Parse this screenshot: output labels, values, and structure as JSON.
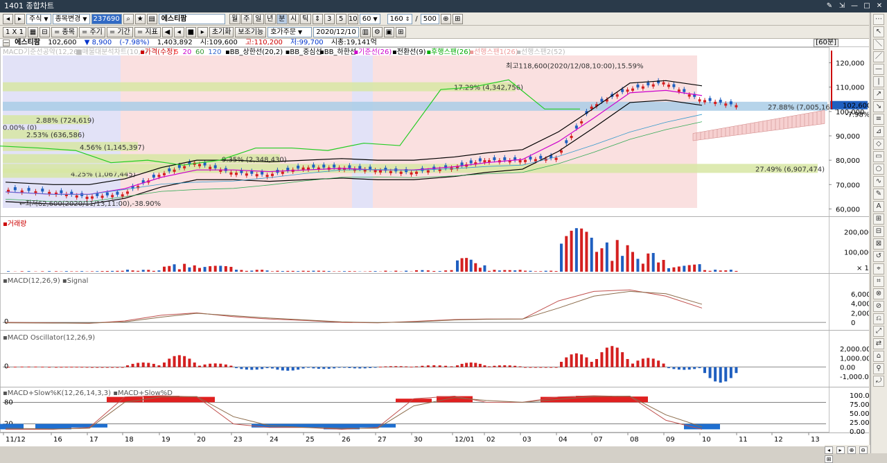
{
  "window": {
    "title": "1401 종합차트",
    "controls": [
      "✎",
      "⇲",
      "—",
      "□",
      "✕"
    ]
  },
  "toolbar1": {
    "nav_prev": "◂",
    "nav_next": "▸",
    "market": "주식",
    "change_label": "종목변경",
    "code": "237690",
    "name": "에스티팜",
    "periods": [
      "월",
      "주",
      "일",
      "년",
      "분",
      "시",
      "틱"
    ],
    "active_period": "분",
    "intervals": [
      "3",
      "5",
      "10"
    ],
    "interval_value": "60",
    "count_value": "160",
    "count_total": "500",
    "tool_icons": [
      "⊕",
      "⊞"
    ]
  },
  "toolbar2": {
    "layout": "1 X 1",
    "tabs": [
      "= 종목",
      "= 주기",
      "= 기간",
      "= 지표"
    ],
    "play_buttons": [
      "◀",
      "◂",
      "■",
      "▸"
    ],
    "reset": "초기화",
    "aux": "보조기능",
    "order": "호가주문",
    "date": "2020/12/10",
    "icons": [
      "⚙",
      "▣",
      "⊞"
    ]
  },
  "info": {
    "name": "에스티팜",
    "price": "102,600",
    "change": "▼ 8,900",
    "change_pct": "(-7.98%)",
    "volume": "1,403,892",
    "open": "시:109,600",
    "high": "고:110,200",
    "low": "저:99,700",
    "mktcap": "시총:19,141억",
    "period_tag": "[60분]"
  },
  "price_panel": {
    "legend": [
      {
        "text": "MACD기준선공약(12,26)",
        "color": "#bbbbbb"
      },
      {
        "text": "■매물대분석차트(10,0)",
        "color": "#bbbbbb"
      },
      {
        "text": "▪가격(수정)",
        "color": "#cc0000"
      },
      {
        "text": "5",
        "color": "#ff3333"
      },
      {
        "text": "20",
        "color": "#cc00cc"
      },
      {
        "text": "60",
        "color": "#339933"
      },
      {
        "text": "120",
        "color": "#3366cc"
      },
      {
        "text": "▪BB_상한선(20,2)",
        "color": "#000000"
      },
      {
        "text": "▪BB_중심선",
        "color": "#000000"
      },
      {
        "text": "▪BB_하한선",
        "color": "#000000"
      },
      {
        "text": "▪기준선(26)",
        "color": "#cc00cc"
      },
      {
        "text": "▪전환선(9)",
        "color": "#000000"
      },
      {
        "text": "▪후행스팬(26)",
        "color": "#00aa00"
      },
      {
        "text": "▪선행스팬1(26)",
        "color": "#ee9999"
      },
      {
        "text": "▪선행스팬2(52)",
        "color": "#bbbbbb"
      }
    ],
    "y_labels": [
      "120,000",
      "110,000",
      "100,000",
      "90,000",
      "80,000",
      "70,000",
      "60,000"
    ],
    "high_note": "최고118,600(2020/12/08,10:00),15.59%",
    "low_note": "←최저62,600(2020/11/13,11:00),-38.90%",
    "current_price_tag": "102,600",
    "current_change_tag": "-7.98%",
    "volume_profile": [
      "17.29% (4,342,756)",
      "27.88% (7,005,163)",
      "2.88% (724,619)",
      "0.00% (0)",
      "2.53% (636,586)",
      "4.56% (1,145,397)",
      "9.35% (2,348,430)",
      "4.25% (1,067,445)",
      "27.49% (6,907,474)"
    ]
  },
  "volume_panel": {
    "legend": "▪거래량",
    "y_labels": [
      "200,000",
      "100,000",
      "× 10"
    ]
  },
  "macd_panel": {
    "legend": "▪MACD(12,26,9) ▪Signal",
    "y_labels": [
      "6,000",
      "4,000",
      "2,000",
      "0"
    ],
    "zero_label": "0"
  },
  "osc_panel": {
    "legend": "▪MACD Oscillator(12,26,9)",
    "y_labels": [
      "2,000.00",
      "1,000.00",
      "0.00",
      "-1,000.00"
    ],
    "zero_label": "0"
  },
  "stoch_panel": {
    "legend": "▪MACD+Slow%K(12,26,14,3,3) ▪MACD+Slow%D",
    "y_labels": [
      "100.00",
      "75.00",
      "50.00",
      "25.00",
      "0.00"
    ],
    "left_labels": [
      "80",
      "20"
    ]
  },
  "x_axis": [
    "11/12",
    "16",
    "17",
    "18",
    "19",
    "20",
    "23",
    "24",
    "25",
    "26",
    "27",
    "30",
    "12/01",
    "02",
    "03",
    "04",
    "07",
    "08",
    "09",
    "10",
    "11",
    "12",
    "13"
  ],
  "chart_data": [
    {
      "type": "candlestick",
      "title": "가격(수정)",
      "ylim": [
        57000,
        123000
      ],
      "x": [
        "11/12",
        "16",
        "17",
        "18",
        "19",
        "20",
        "23",
        "24",
        "25",
        "26",
        "27",
        "30",
        "12/01",
        "02",
        "03",
        "04",
        "07",
        "08",
        "09",
        "10"
      ],
      "close_approx": [
        67000,
        65000,
        66000,
        74000,
        79000,
        75000,
        74000,
        77000,
        77000,
        76000,
        75000,
        77000,
        80000,
        80000,
        81000,
        102000,
        109000,
        112000,
        105000,
        102600
      ],
      "high": 118600,
      "low": 62600,
      "last": 102600
    },
    {
      "type": "bar",
      "title": "거래량",
      "ylim": [
        0,
        230000
      ],
      "values_approx": [
        3000,
        3000,
        5000,
        10000,
        40000,
        30000,
        10000,
        5000,
        5000,
        3000,
        5000,
        8000,
        70000,
        10000,
        5000,
        220000,
        160000,
        100000,
        40000,
        10000
      ]
    },
    {
      "type": "line",
      "title": "MACD(12,26,9)",
      "ylim": [
        -1000,
        8000
      ],
      "series": [
        {
          "name": "MACD",
          "values": [
            0,
            -100,
            -200,
            300,
            1500,
            2000,
            1200,
            700,
            400,
            0,
            -100,
            200,
            600,
            700,
            700,
            4500,
            6500,
            6800,
            5500,
            3000
          ]
        },
        {
          "name": "Signal",
          "values": [
            -100,
            -150,
            -150,
            100,
            1100,
            1900,
            1400,
            900,
            500,
            100,
            -50,
            100,
            500,
            650,
            700,
            3000,
            5500,
            6500,
            6000,
            3800
          ]
        }
      ]
    },
    {
      "type": "bar",
      "title": "MACD Oscillator(12,26,9)",
      "ylim": [
        -2000,
        3000
      ],
      "values_approx": [
        50,
        30,
        0,
        500,
        1300,
        400,
        -300,
        -400,
        -200,
        -150,
        100,
        200,
        500,
        200,
        0,
        1500,
        2300,
        1000,
        -300,
        -1700
      ]
    },
    {
      "type": "line",
      "title": "MACD+Slow%K(12,26,14,3,3)",
      "ylim": [
        0,
        100
      ],
      "series": [
        {
          "name": "MACD+Slow%K",
          "values": [
            5,
            5,
            10,
            95,
            98,
            95,
            20,
            10,
            10,
            5,
            10,
            90,
            97,
            80,
            80,
            95,
            98,
            96,
            30,
            5
          ]
        },
        {
          "name": "MACD+Slow%D",
          "values": [
            8,
            6,
            8,
            80,
            95,
            96,
            40,
            15,
            10,
            8,
            8,
            70,
            93,
            85,
            80,
            88,
            96,
            97,
            45,
            12
          ]
        }
      ]
    }
  ],
  "right_tools": [
    "⋯",
    "↖",
    "＼",
    "／",
    "—",
    "|",
    "↗",
    "↘",
    "≡",
    "⊿",
    "◇",
    "▭",
    "○",
    "∿",
    "✎",
    "A",
    "⊞",
    "⊟",
    "⊠",
    "↺",
    "⌖",
    "⌗",
    "⊗",
    "⊘",
    "⎌",
    "⤢",
    "⇄",
    "⌂",
    "⚲",
    "⤾"
  ],
  "hscroll": [
    "◂",
    "▸",
    "⊕",
    "⊖",
    "⊞"
  ]
}
